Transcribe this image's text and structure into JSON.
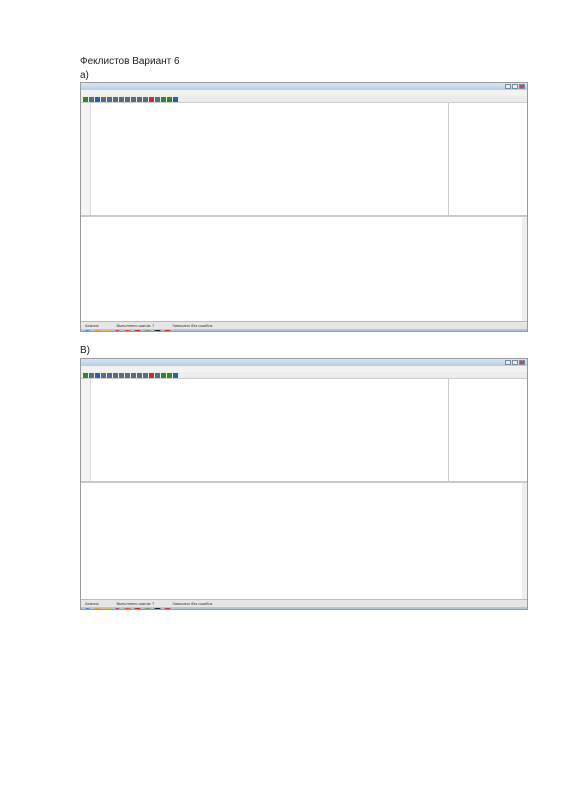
{
  "document": {
    "title": "Феклистов Вариант 6",
    "section_a": "а)",
    "section_b": "В)"
  },
  "shot_a": {
    "status_items": [
      "Анализ",
      "Выполнено шагов: 7",
      "Записано без ошибок"
    ]
  },
  "shot_b": {
    "status_items": [
      "Анализ",
      "Выполнено шагов: 7",
      "Записано без ошибок"
    ]
  },
  "icons": {
    "taskbar": [
      "start-orb-icon",
      "media-player-icon",
      "folder-icon",
      "opera-icon",
      "office-icon",
      "yandex-icon",
      "tool-icon",
      "kumir-icon",
      "yandex-browser-icon"
    ],
    "colors": {
      "taskbar": "#8fa8c4",
      "code": "#1a3f9a",
      "titlebar": "#b9cde6"
    }
  }
}
